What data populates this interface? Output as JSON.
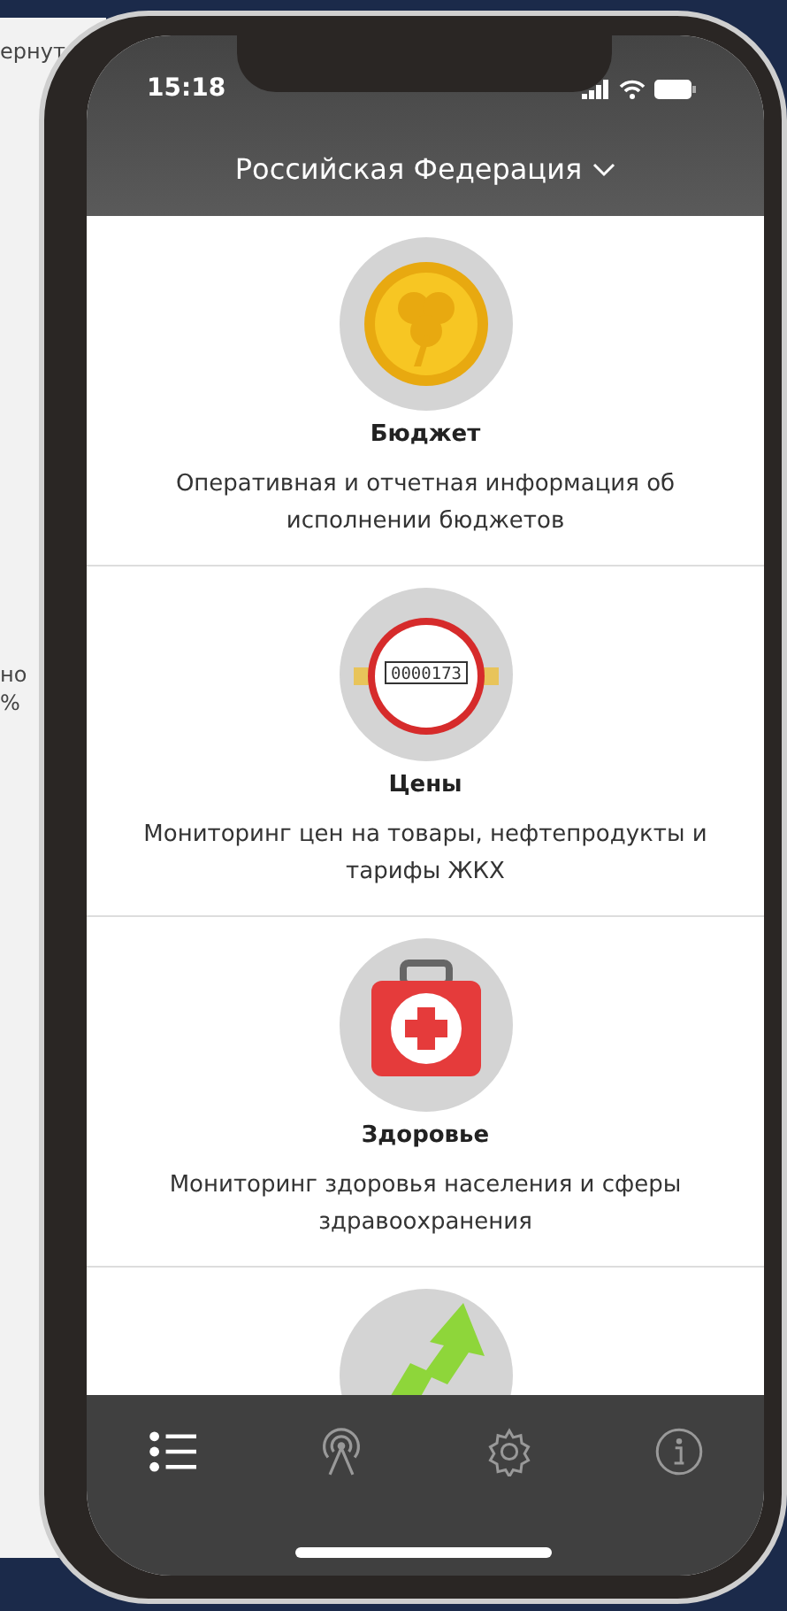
{
  "background_texts": [
    "ернут",
    "но",
    "%"
  ],
  "status_bar": {
    "time": "15:18"
  },
  "header": {
    "title": "Российская Федерация"
  },
  "sections": [
    {
      "kind": "coin",
      "title": "Бюджет",
      "description": "Оперативная и отчетная информация об исполнении бюджетов"
    },
    {
      "kind": "meter",
      "title": "Цены",
      "description": "Мониторинг цен на товары, нефтепродукты и тарифы ЖКХ",
      "meter_reading": "0000173"
    },
    {
      "kind": "medkit",
      "title": "Здоровье",
      "description": "Мониторинг здоровья населения и сферы здравоохранения"
    },
    {
      "kind": "arrow"
    }
  ],
  "tabs": [
    {
      "kind": "list",
      "selected": true
    },
    {
      "kind": "antenna",
      "selected": false
    },
    {
      "kind": "gear",
      "selected": false
    },
    {
      "kind": "info",
      "selected": false
    }
  ]
}
